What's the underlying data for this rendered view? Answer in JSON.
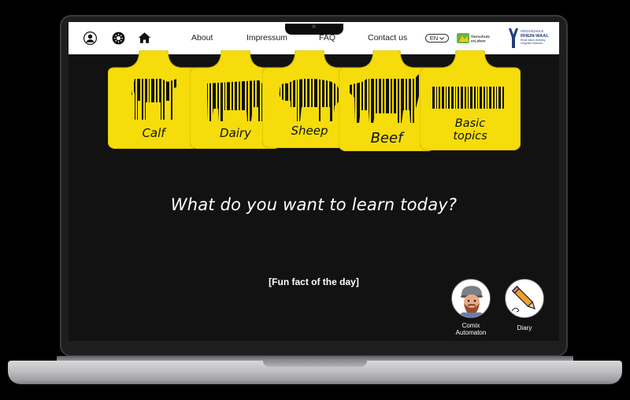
{
  "nav": {
    "about": "About",
    "impressum": "Impressum",
    "faq": "FAQ",
    "contact": "Contact us",
    "language": "EN",
    "icons": [
      "user-icon",
      "theme-toggle-icon",
      "home-icon"
    ]
  },
  "logos": {
    "partner": [
      "Tierschutz",
      "erLeben"
    ],
    "university": [
      "HOCHSCHULE",
      "RHEIN-WAAL",
      "Rhine-Waal University",
      "of Applied Sciences"
    ]
  },
  "categories": [
    {
      "label": "Calf",
      "icon": "calf-barcode-icon"
    },
    {
      "label": "Dairy",
      "icon": "dairy-cow-barcode-icon"
    },
    {
      "label": "Sheep",
      "icon": "sheep-barcode-icon"
    },
    {
      "label": "Beef",
      "icon": "beef-cattle-barcode-icon"
    },
    {
      "label_line1": "Basic",
      "label_line2": "topics",
      "icon": "barcode-icon"
    }
  ],
  "headline": "What do you want to learn today?",
  "fun_fact": "[Fun fact of the day]",
  "tools": {
    "comix_line1": "Comix",
    "comix_line2": "Automaton",
    "diary": "Diary"
  },
  "colors": {
    "tag_yellow": "#f5dc0a",
    "screen_bg": "#121212",
    "nav_bg": "#ffffff"
  }
}
